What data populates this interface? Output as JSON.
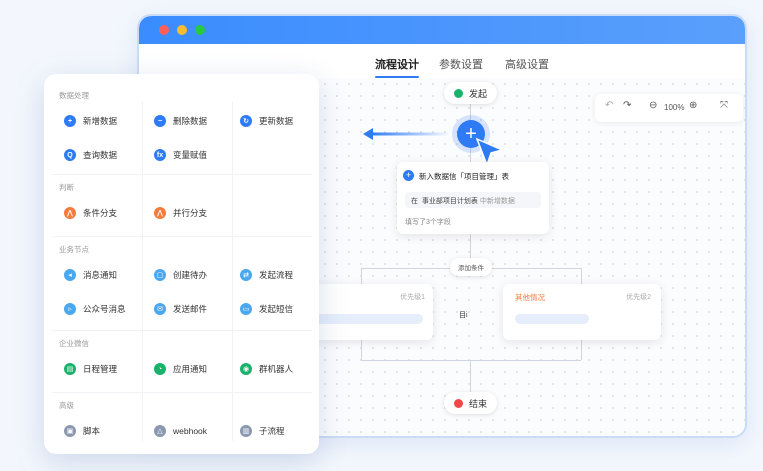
{
  "window": {
    "dots": [
      "#ff5f57",
      "#febc2e",
      "#28c840"
    ],
    "tabs": [
      {
        "label": "流程设计",
        "active": true
      },
      {
        "label": "参数设置",
        "active": false
      },
      {
        "label": "高级设置",
        "active": false
      }
    ]
  },
  "toolbar": {
    "undo": "↶",
    "redo": "↷",
    "zoom_out": "⊖",
    "zoom": "100%",
    "zoom_in": "⊕",
    "fit": "⤧"
  },
  "flow": {
    "start": "发起",
    "end": "结束",
    "add_condition": "添加条件",
    "insert_card": {
      "title": "新入数据信「项目管理」表",
      "prefix": "在",
      "target": "事业部项目计划表",
      "action": "中新增数据",
      "footer": "填写了3个字段"
    },
    "branch_left": {
      "label": "",
      "priority": "优先级1",
      "bar_text": "目i"
    },
    "branch_right": {
      "label": "其他情况",
      "priority": "优先级2"
    }
  },
  "colors": {
    "accent": "#2f7bf6",
    "orange": "#f47b3b",
    "green": "#18b26b",
    "red": "#f04848"
  },
  "menu": {
    "sections": [
      {
        "title": "数据处理",
        "items": [
          {
            "label": "新增数据",
            "icon": "plus-icon",
            "glyph": "+",
            "color": "#2f7bf6"
          },
          {
            "label": "删除数据",
            "icon": "minus-icon",
            "glyph": "−",
            "color": "#2f7bf6"
          },
          {
            "label": "更新数据",
            "icon": "refresh-icon",
            "glyph": "↻",
            "color": "#2f7bf6"
          },
          {
            "label": "查询数据",
            "icon": "search-icon",
            "glyph": "Q",
            "color": "#2f7bf6"
          },
          {
            "label": "变量赋值",
            "icon": "function-icon",
            "glyph": "fx",
            "color": "#2f7bf6"
          }
        ]
      },
      {
        "title": "判断",
        "items": [
          {
            "label": "条件分支",
            "icon": "branch-icon",
            "glyph": "⋀",
            "color": "#f47b3b"
          },
          {
            "label": "并行分支",
            "icon": "parallel-icon",
            "glyph": "⋀",
            "color": "#f47b3b"
          }
        ]
      },
      {
        "title": "业务节点",
        "items": [
          {
            "label": "消息通知",
            "icon": "notify-icon",
            "glyph": "◂",
            "color": "#4aa8f0"
          },
          {
            "label": "创建待办",
            "icon": "todo-icon",
            "glyph": "▢",
            "color": "#4aa8f0"
          },
          {
            "label": "发起流程",
            "icon": "flow-icon",
            "glyph": "⇄",
            "color": "#4aa8f0"
          },
          {
            "label": "公众号消息",
            "icon": "wechat-icon",
            "glyph": "▹",
            "color": "#4aa8f0"
          },
          {
            "label": "发送邮件",
            "icon": "mail-icon",
            "glyph": "✉",
            "color": "#4aa8f0"
          },
          {
            "label": "发起短信",
            "icon": "sms-icon",
            "glyph": "▭",
            "color": "#4aa8f0"
          }
        ]
      },
      {
        "title": "企业微信",
        "items": [
          {
            "label": "日程管理",
            "icon": "calendar-icon",
            "glyph": "▤",
            "color": "#18b26b"
          },
          {
            "label": "应用通知",
            "icon": "bell-icon",
            "glyph": "◔",
            "color": "#18b26b"
          },
          {
            "label": "群机器人",
            "icon": "robot-icon",
            "glyph": "◉",
            "color": "#18b26b"
          }
        ]
      },
      {
        "title": "高级",
        "items": [
          {
            "label": "脚本",
            "icon": "script-icon",
            "glyph": "▣",
            "color": "#8a98b0"
          },
          {
            "label": "webhook",
            "icon": "webhook-icon",
            "glyph": "△",
            "color": "#8a98b0"
          },
          {
            "label": "子流程",
            "icon": "subflow-icon",
            "glyph": "▥",
            "color": "#8a98b0"
          }
        ]
      }
    ]
  }
}
